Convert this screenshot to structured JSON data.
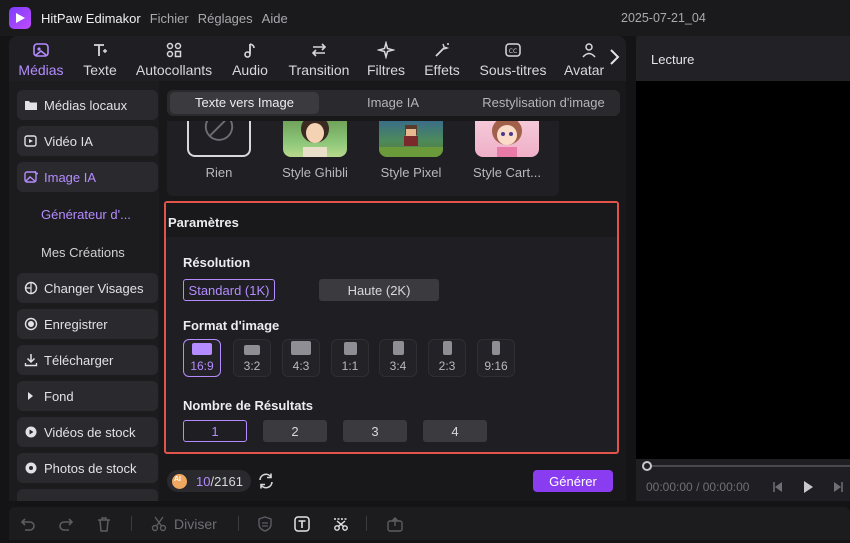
{
  "app": {
    "name": "HitPaw Edimakor",
    "menu": [
      "Fichier",
      "Réglages",
      "Aide"
    ],
    "project_title": "2025-07-21_04"
  },
  "tabs": [
    {
      "label": "Médias",
      "icon": "media-icon",
      "active": true
    },
    {
      "label": "Texte",
      "icon": "text-icon"
    },
    {
      "label": "Autocollants",
      "icon": "sticker-icon"
    },
    {
      "label": "Audio",
      "icon": "music-note-icon"
    },
    {
      "label": "Transition",
      "icon": "transition-arrows-icon"
    },
    {
      "label": "Filtres",
      "icon": "sparkle-icon"
    },
    {
      "label": "Effets",
      "icon": "magic-wand-icon"
    },
    {
      "label": "Sous-titres",
      "icon": "cc-icon"
    },
    {
      "label": "Avatar",
      "icon": "avatar-icon"
    }
  ],
  "sidebar": {
    "items": [
      {
        "label": "Médias locaux",
        "icon": "folder-icon"
      },
      {
        "label": "Vidéo IA",
        "icon": "ai-video-icon"
      },
      {
        "label": "Image IA",
        "icon": "ai-image-icon",
        "active": true
      },
      {
        "label": "Changer Visages",
        "icon": "face-swap-icon"
      },
      {
        "label": "Enregistrer",
        "icon": "record-icon"
      },
      {
        "label": "Télécharger",
        "icon": "download-icon"
      },
      {
        "label": "Fond",
        "icon": "caret-right-icon"
      },
      {
        "label": "Vidéos de stock",
        "icon": "stock-video-icon"
      },
      {
        "label": "Photos de stock",
        "icon": "stock-photo-icon"
      }
    ],
    "subitems": [
      {
        "label": "Générateur d'...",
        "active": true
      },
      {
        "label": "Mes Créations"
      }
    ]
  },
  "main": {
    "subtabs": [
      {
        "label": "Texte vers Image",
        "active": true
      },
      {
        "label": "Image IA"
      },
      {
        "label": "Restylisation d'image"
      }
    ],
    "styles": [
      {
        "label": "Rien"
      },
      {
        "label": "Style Ghibli"
      },
      {
        "label": "Style Pixel"
      },
      {
        "label": "Style Cart..."
      }
    ],
    "params": {
      "title": "Paramètres",
      "resolution": {
        "title": "Résolution",
        "options": [
          "Standard (1K)",
          "Haute (2K)"
        ],
        "selected": "Standard (1K)"
      },
      "format": {
        "title": "Format d'image",
        "options": [
          "16:9",
          "3:2",
          "4:3",
          "1:1",
          "3:4",
          "2:3",
          "9:16"
        ],
        "selected": "16:9"
      },
      "results": {
        "title": "Nombre de Résultats",
        "options": [
          "1",
          "2",
          "3",
          "4"
        ],
        "selected": "1"
      }
    },
    "credits": {
      "used": "10",
      "total": "/2161"
    },
    "generate_label": "Générer"
  },
  "preview": {
    "title": "Lecture",
    "time_current": "00:00:00",
    "time_separator": "/",
    "time_total": "00:00:00"
  },
  "bottombar": {
    "split_label": "Diviser"
  },
  "colors": {
    "accent": "#b48cff",
    "generate": "#8a3cf0",
    "highlight_border": "#e2544a"
  }
}
